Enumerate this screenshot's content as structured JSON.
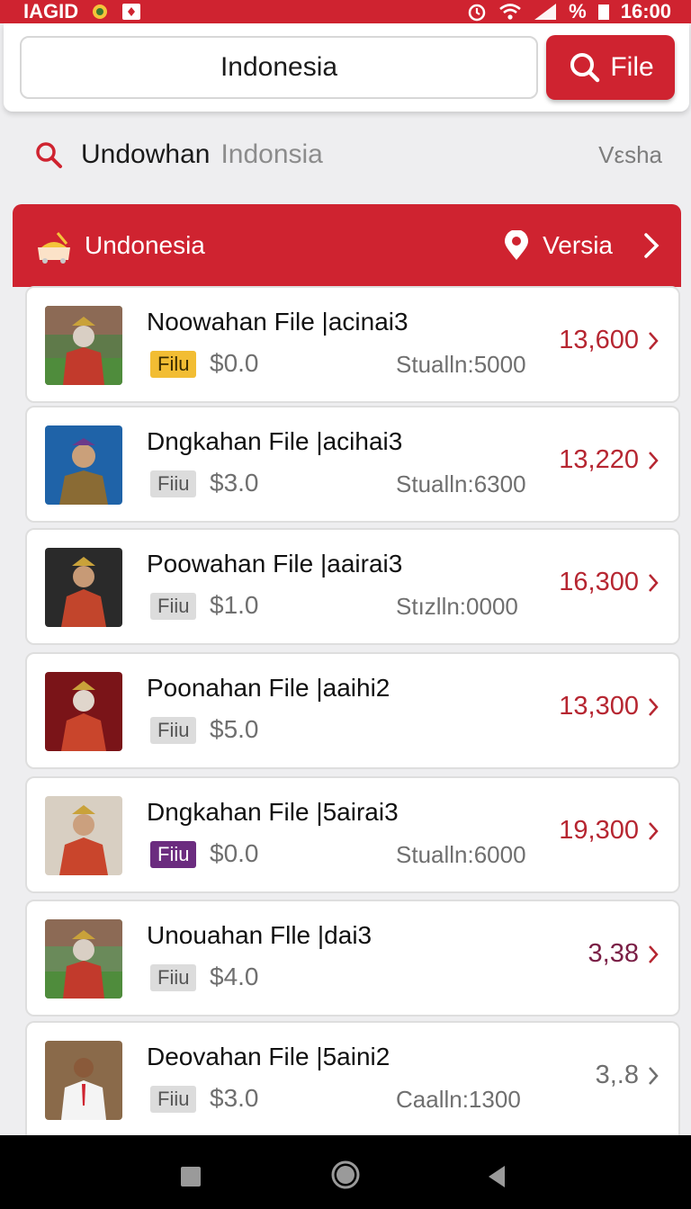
{
  "status_bar": {
    "carrier": "IAGID",
    "time": "16:00",
    "battery_text": "%"
  },
  "header": {
    "search_value": "Indonesia",
    "file_button_label": "File"
  },
  "search_row": {
    "term": "Undowhan",
    "subterm": "Indonsia",
    "right_label": "Vεsha"
  },
  "section": {
    "title": "Undonesia",
    "right_label": "Versia"
  },
  "colors": {
    "brand_red": "#cf2330",
    "value_red": "#b62631",
    "value_plum": "#7a1f46",
    "badge_yellow": "#f2bd33",
    "badge_grey": "#dcdcdc",
    "badge_purple": "#6b2c7f"
  },
  "items": [
    {
      "title": "Noowahan File |acinai3",
      "badge": "Filu",
      "price": "$0.0",
      "stat": "Stualln:5000",
      "value": "13,600"
    },
    {
      "title": "Dngkahan File |acihai3",
      "badge": "Fiiu",
      "price": "$3.0",
      "stat": "Stualln:6300",
      "value": "13,220"
    },
    {
      "title": "Poowahan File |aairai3",
      "badge": "Fiiu",
      "price": "$1.0",
      "stat": "Stızlln:0000",
      "value": "16,300"
    },
    {
      "title": "Poonahan File |aaihi2",
      "badge": "Fiiu",
      "price": "$5.0",
      "stat": "",
      "value": "13,300"
    },
    {
      "title": "Dngkahan File |5airai3",
      "badge": "Fiiu",
      "price": "$0.0",
      "stat": "Stualln:6000",
      "value": "19,300"
    },
    {
      "title": "Unouahan Flle |dai3",
      "badge": "Fiiu",
      "price": "$4.0",
      "stat": "",
      "value": "3,38"
    },
    {
      "title": "Deovahan File |5aini2",
      "badge": "Fiiu",
      "price": "$3.0",
      "stat": "Caalln:1300",
      "value": "3,.8"
    }
  ]
}
